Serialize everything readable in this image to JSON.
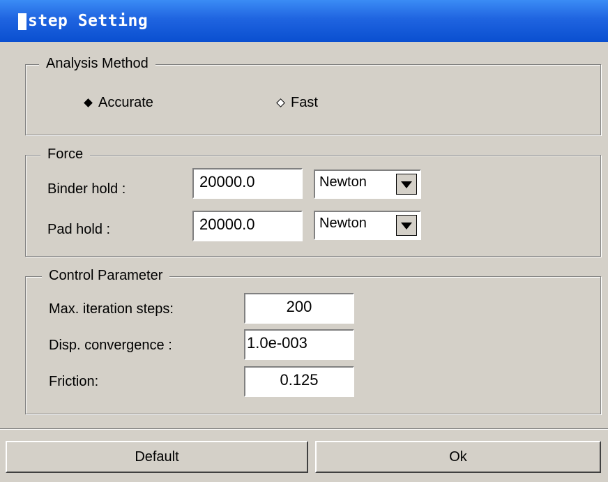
{
  "window": {
    "title": "step Setting"
  },
  "analysis": {
    "legend": "Analysis Method",
    "options": [
      {
        "label": "Accurate",
        "selected": true
      },
      {
        "label": "Fast",
        "selected": false
      }
    ]
  },
  "force": {
    "legend": "Force",
    "binder": {
      "label": "Binder hold :",
      "value": "20000.0",
      "unit": "Newton"
    },
    "pad": {
      "label": "Pad hold :",
      "value": "20000.0",
      "unit": "Newton"
    }
  },
  "control": {
    "legend": "Control Parameter",
    "max_iter": {
      "label": "Max. iteration steps:",
      "value": "200"
    },
    "disp": {
      "label": "Disp. convergence :",
      "value": "1.0e-003"
    },
    "friction": {
      "label": "Friction:",
      "value": "0.125"
    }
  },
  "buttons": {
    "default_label": "Default",
    "ok_label": "Ok"
  }
}
